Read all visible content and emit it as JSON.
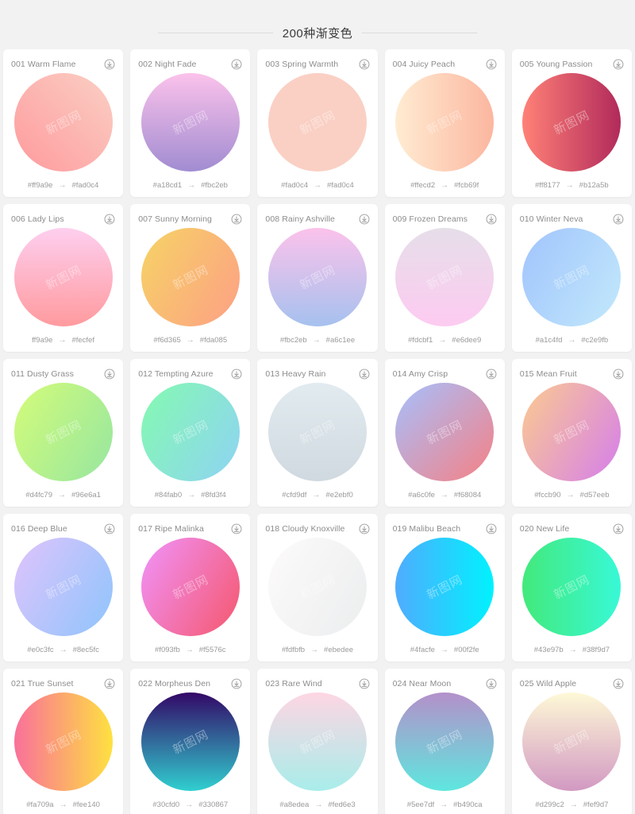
{
  "header": {
    "title": "200种渐变色"
  },
  "icons": {
    "download": "download-icon"
  },
  "watermark": "新图网",
  "cards": [
    {
      "title": "001 Warm Flame",
      "from": "#ff9a9e",
      "to": "#fad0c4",
      "from_label": "#ff9a9e",
      "to_label": "#fad0c4",
      "angle": 45
    },
    {
      "title": "002 Night Fade",
      "from": "#a18cd1",
      "to": "#fbc2eb",
      "from_label": "#a18cd1",
      "to_label": "#fbc2eb",
      "angle": 0
    },
    {
      "title": "003 Spring Warmth",
      "from": "#fad0c4",
      "to": "#fad0c4",
      "from_label": "#fad0c4",
      "to_label": "#fad0c4",
      "angle": 0
    },
    {
      "title": "004 Juicy Peach",
      "from": "#ffecd2",
      "to": "#fcb69f",
      "from_label": "#ffecd2",
      "to_label": "#fcb69f",
      "angle": 90
    },
    {
      "title": "005 Young Passion",
      "from": "#ff8177",
      "to": "#b12a5b",
      "from_label": "#ff8177",
      "to_label": "#b12a5b",
      "angle": 90
    },
    {
      "title": "006 Lady Lips",
      "from": "#ff9a9e",
      "to": "#fecfef",
      "from_label": "ff9a9e",
      "to_label": "#fecfef",
      "angle": 0
    },
    {
      "title": "007 Sunny Morning",
      "from": "#f6d365",
      "to": "#fda085",
      "from_label": "#f6d365",
      "to_label": "#fda085",
      "angle": 120
    },
    {
      "title": "008 Rainy Ashville",
      "from": "#fbc2eb",
      "to": "#a6c1ee",
      "from_label": "#fbc2eb",
      "to_label": "#a6c1ee",
      "angle": 180
    },
    {
      "title": "009 Frozen Dreams",
      "from": "#fdcbf1",
      "to": "#e6dee9",
      "from_label": "#fdcbf1",
      "to_label": "#e6dee9",
      "angle": 0
    },
    {
      "title": "010 Winter Neva",
      "from": "#a1c4fd",
      "to": "#c2e9fb",
      "from_label": "#a1c4fd",
      "to_label": "#c2e9fb",
      "angle": 120
    },
    {
      "title": "011 Dusty Grass",
      "from": "#d4fc79",
      "to": "#96e6a1",
      "from_label": "#d4fc79",
      "to_label": "#96e6a1",
      "angle": 120
    },
    {
      "title": "012 Tempting Azure",
      "from": "#84fab0",
      "to": "#8fd3f4",
      "from_label": "#84fab0",
      "to_label": "#8fd3f4",
      "angle": 120
    },
    {
      "title": "013 Heavy Rain",
      "from": "#cfd9df",
      "to": "#e2ebf0",
      "from_label": "#cfd9df",
      "to_label": "#e2ebf0",
      "angle": 0
    },
    {
      "title": "014 Amy Crisp",
      "from": "#a6c0fe",
      "to": "#f68084",
      "from_label": "#a6c0fe",
      "to_label": "#f68084",
      "angle": 135
    },
    {
      "title": "015 Mean Fruit",
      "from": "#fccb90",
      "to": "#d57eeb",
      "from_label": "#fccb90",
      "to_label": "#d57eeb",
      "angle": 120
    },
    {
      "title": "016 Deep Blue",
      "from": "#e0c3fc",
      "to": "#8ec5fc",
      "from_label": "#e0c3fc",
      "to_label": "#8ec5fc",
      "angle": 120
    },
    {
      "title": "017 Ripe Malinka",
      "from": "#f093fb",
      "to": "#f5576c",
      "from_label": "#f093fb",
      "to_label": "#f5576c",
      "angle": 120
    },
    {
      "title": "018 Cloudy Knoxville",
      "from": "#fdfbfb",
      "to": "#ebedee",
      "from_label": "#fdfbfb",
      "to_label": "#ebedee",
      "angle": 120
    },
    {
      "title": "019 Malibu Beach",
      "from": "#4facfe",
      "to": "#00f2fe",
      "from_label": "#4facfe",
      "to_label": "#00f2fe",
      "angle": 90
    },
    {
      "title": "020 New Life",
      "from": "#43e97b",
      "to": "#38f9d7",
      "from_label": "#43e97b",
      "to_label": "#38f9d7",
      "angle": 90
    },
    {
      "title": "021 True Sunset",
      "from": "#fa709a",
      "to": "#fee140",
      "from_label": "#fa709a",
      "to_label": "#fee140",
      "angle": 90
    },
    {
      "title": "022 Morpheus Den",
      "from": "#30cfd0",
      "to": "#330867",
      "from_label": "#30cfd0",
      "to_label": "#330867",
      "angle": 0
    },
    {
      "title": "023 Rare Wind",
      "from": "#a8edea",
      "to": "#fed6e3",
      "from_label": "#a8edea",
      "to_label": "#fed6e3",
      "angle": 0
    },
    {
      "title": "024 Near Moon",
      "from": "#5ee7df",
      "to": "#b490ca",
      "from_label": "#5ee7df",
      "to_label": "#b490ca",
      "angle": 0
    },
    {
      "title": "025 Wild Apple",
      "from": "#d299c2",
      "to": "#fef9d7",
      "from_label": "#d299c2",
      "to_label": "#fef9d7",
      "angle": 0
    }
  ]
}
